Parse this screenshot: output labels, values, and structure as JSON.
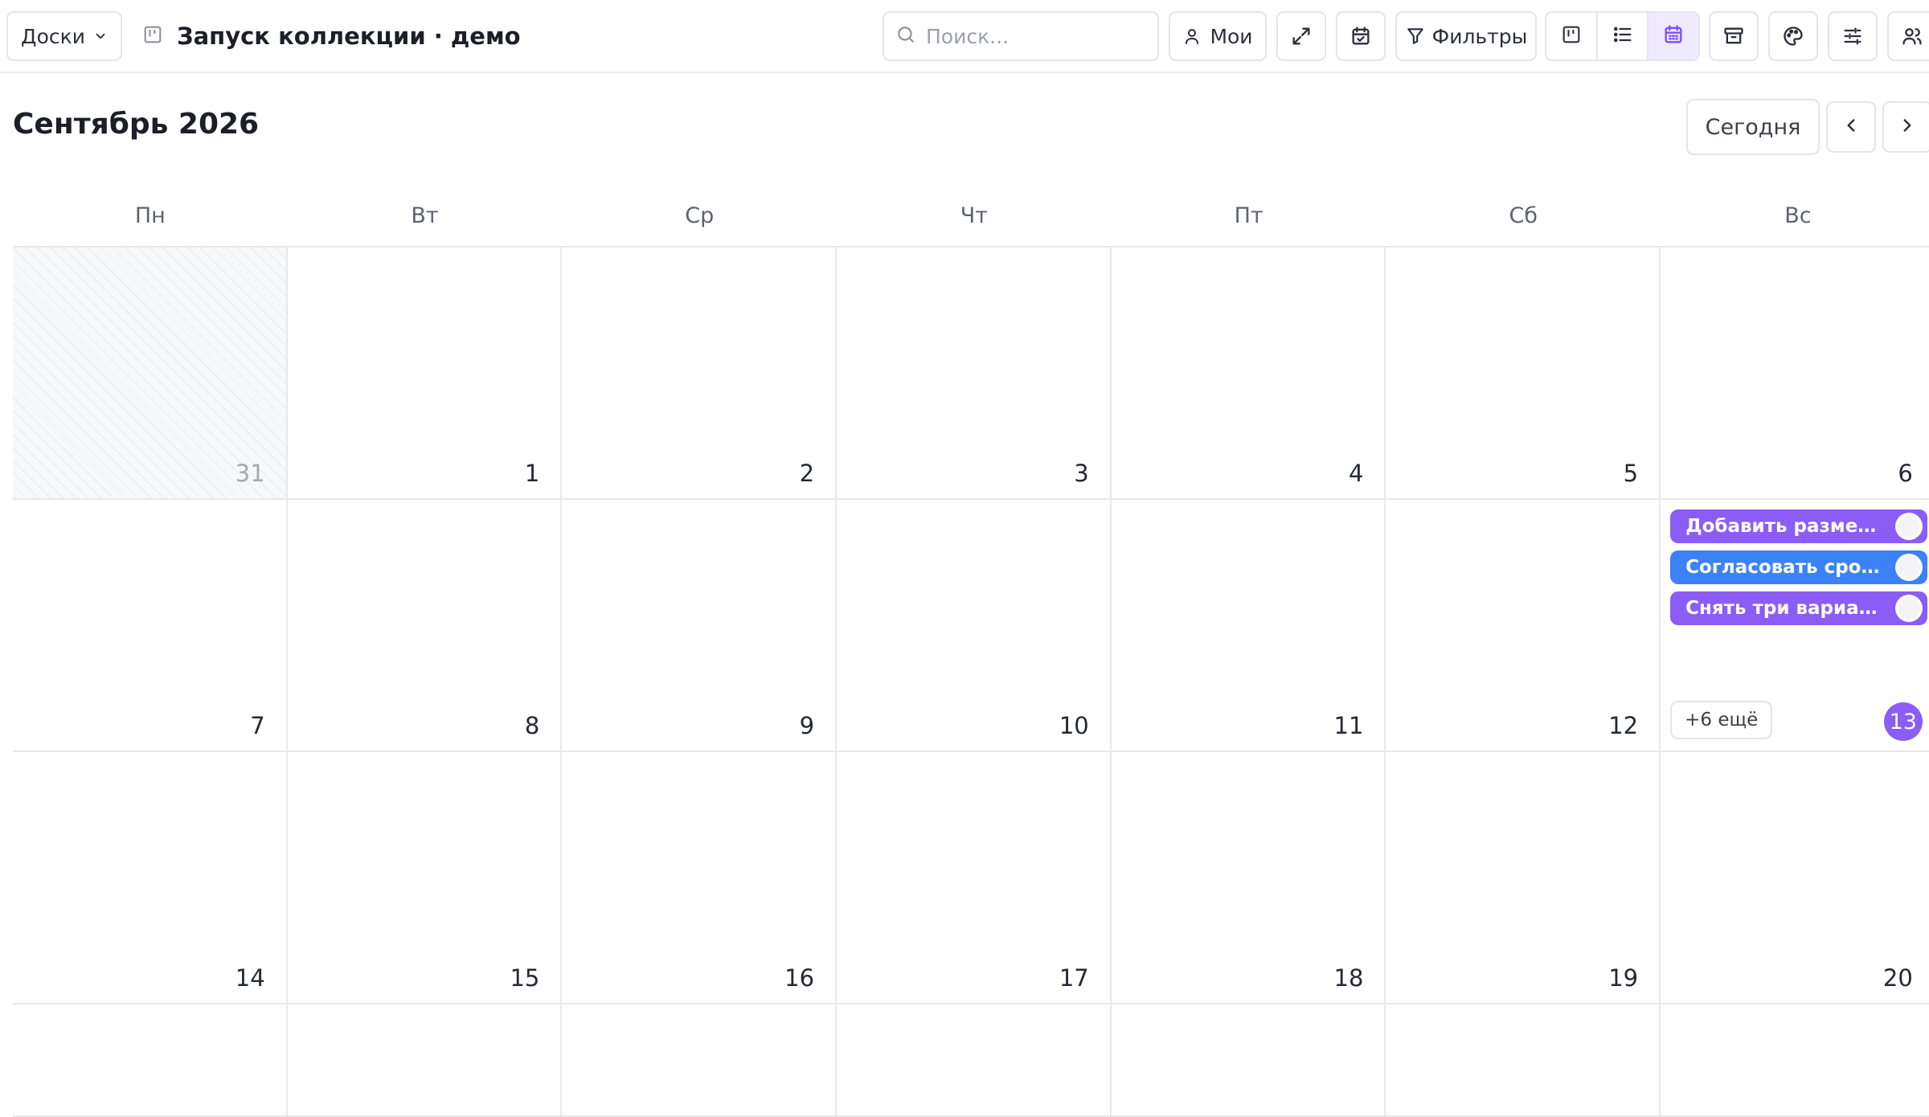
{
  "toolbar": {
    "boards_label": "Доски",
    "board_title": "Запуск коллекции · демо",
    "search_placeholder": "Поиск...",
    "mine_label": "Мои",
    "filters_label": "Фильтры",
    "active_view": "calendar",
    "accent_color": "#8b5cf6"
  },
  "calendar": {
    "month_title": "Сентябрь 2026",
    "today_label": "Сегодня",
    "weekdays": [
      "Пн",
      "Вт",
      "Ср",
      "Чт",
      "Пт",
      "Сб",
      "Вс"
    ],
    "today": "13",
    "weeks": [
      [
        {
          "day": "31",
          "outside": true
        },
        {
          "day": "1"
        },
        {
          "day": "2"
        },
        {
          "day": "3"
        },
        {
          "day": "4"
        },
        {
          "day": "5"
        },
        {
          "day": "6"
        }
      ],
      [
        {
          "day": "7"
        },
        {
          "day": "8"
        },
        {
          "day": "9"
        },
        {
          "day": "10"
        },
        {
          "day": "11"
        },
        {
          "day": "12"
        },
        {
          "day": "13",
          "today": true,
          "events": [
            {
              "label": "Добавить размер...",
              "color": "#8b5cf6"
            },
            {
              "label": "Согласовать срок...",
              "color": "#3b82f6"
            },
            {
              "label": "Снять три вариан...",
              "color": "#8b5cf6"
            }
          ],
          "more_label": "+6 ещё"
        }
      ],
      [
        {
          "day": "14"
        },
        {
          "day": "15"
        },
        {
          "day": "16"
        },
        {
          "day": "17"
        },
        {
          "day": "18"
        },
        {
          "day": "19"
        },
        {
          "day": "20"
        }
      ],
      [
        {
          "day": ""
        },
        {
          "day": ""
        },
        {
          "day": ""
        },
        {
          "day": ""
        },
        {
          "day": ""
        },
        {
          "day": ""
        },
        {
          "day": ""
        }
      ]
    ]
  }
}
